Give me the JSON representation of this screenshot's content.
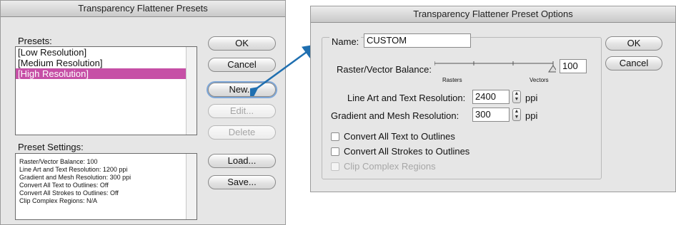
{
  "presets_dialog": {
    "title": "Transparency Flattener Presets",
    "presets_label": "Presets:",
    "presets": [
      "[Low Resolution]",
      "[Medium Resolution]",
      "[High Resolution]"
    ],
    "selected_index": 2,
    "settings_label": "Preset Settings:",
    "settings_lines": [
      "Raster/Vector Balance: 100",
      "Line Art and Text Resolution: 1200 ppi",
      "Gradient and Mesh Resolution: 300 ppi",
      "Convert All Text to Outlines: Off",
      "Convert All Strokes to Outlines: Off",
      "Clip Complex Regions: N/A"
    ],
    "buttons": {
      "ok": "OK",
      "cancel": "Cancel",
      "new": "New...",
      "edit": "Edit...",
      "delete": "Delete",
      "load": "Load...",
      "save": "Save..."
    }
  },
  "options_dialog": {
    "title": "Transparency Flattener Preset Options",
    "name_label": "Name:",
    "name_value": "CUSTOM",
    "balance_label": "Raster/Vector Balance:",
    "balance_value": "100",
    "slider_min_label": "Rasters",
    "slider_max_label": "Vectors",
    "slider_level": 1.0,
    "line_art_label": "Line Art and Text Resolution:",
    "line_art_value": "2400",
    "gradient_label": "Gradient and Mesh Resolution:",
    "gradient_value": "300",
    "unit": "ppi",
    "checkboxes": {
      "convert_text": "Convert All Text to Outlines",
      "convert_strokes": "Convert All Strokes to Outlines",
      "clip_regions": "Clip Complex Regions"
    },
    "buttons": {
      "ok": "OK",
      "cancel": "Cancel"
    }
  },
  "colors": {
    "selection": "#c64fa6",
    "arrow": "#1f6fb0"
  },
  "icons": [
    "stepper-up-down-icon",
    "slider-thumb-icon",
    "double-headed-arrow-icon"
  ]
}
